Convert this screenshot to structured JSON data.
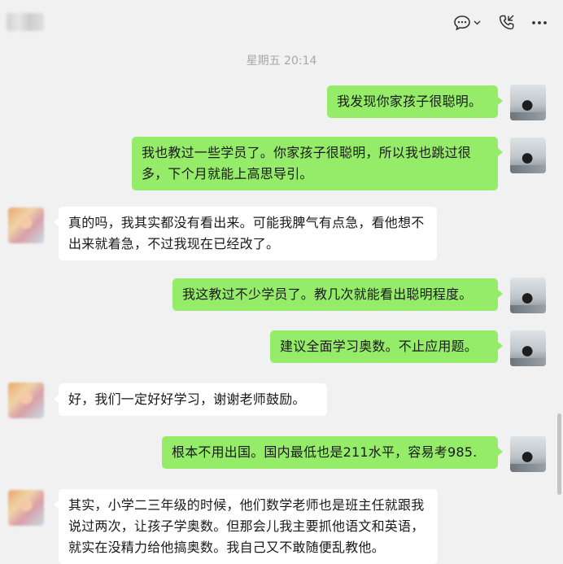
{
  "header": {
    "contact_name": "",
    "chat_info_label": "…",
    "call_label": "",
    "more_label": "…"
  },
  "chat": {
    "timestamp": "星期五 20:14",
    "messages": [
      {
        "sender": "me",
        "text": "我发现你家孩子很聪明。"
      },
      {
        "sender": "me",
        "text": "我也教过一些学员了。你家孩子很聪明，所以我也跳过很多，下个月就能上高思导引。"
      },
      {
        "sender": "them",
        "text": "真的吗，我其实都没有看出来。可能我脾气有点急，看他想不出来就着急，不过我现在已经改了。"
      },
      {
        "sender": "me",
        "text": "我这教过不少学员了。教几次就能看出聪明程度。"
      },
      {
        "sender": "me",
        "text": "建议全面学习奥数。不止应用题。"
      },
      {
        "sender": "them",
        "text": "好，我们一定好好学习，谢谢老师鼓励。"
      },
      {
        "sender": "me",
        "text": "根本不用出国。国内最低也是211水平，容易考985."
      },
      {
        "sender": "them",
        "text": "其实，小学二三年级的时候，他们数学老师也是班主任就跟我说过两次，让孩子学奥数。但那会儿我主要抓他语文和英语，就实在没精力给他搞奥数。我自己又不敢随便乱教他。"
      }
    ]
  },
  "colors": {
    "background": "#f1f1f1",
    "my_bubble": "#95ec69",
    "their_bubble": "#ffffff",
    "timestamp_text": "#a8a8a8"
  },
  "icons": [
    "chat-info-icon",
    "chevron-down-icon",
    "voice-call-icon",
    "more-icon"
  ]
}
